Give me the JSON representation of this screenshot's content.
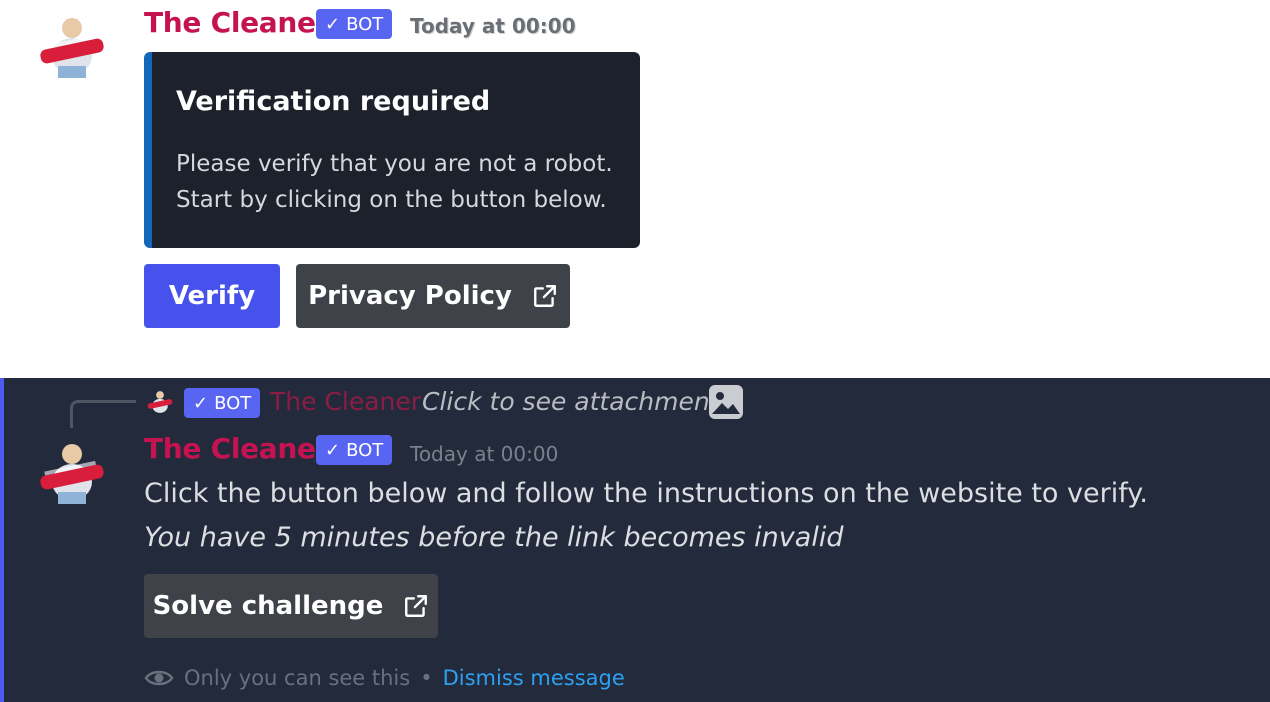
{
  "top_message": {
    "author": "The Cleaner",
    "badge": "BOT",
    "timestamp": "Today at 00:00",
    "embed": {
      "title": "Verification required",
      "description": "Please verify that you are not a robot.\nStart by clicking on the button below.",
      "accent_color": "#1267b9"
    },
    "buttons": {
      "verify": "Verify",
      "privacy": "Privacy Policy"
    }
  },
  "bottom_message": {
    "reply": {
      "badge": "BOT",
      "author": "The Cleaner",
      "text": "Click to see attachment",
      "icon": "image-icon"
    },
    "author": "The Cleaner",
    "badge": "BOT",
    "timestamp": "Today at 00:00",
    "line1": "Click the button below and follow the instructions on the website to verify.",
    "line2": "You have 5 minutes before the link becomes invalid",
    "button": "Solve challenge",
    "footer": {
      "only_you": "Only you can see this",
      "separator": "•",
      "dismiss": "Dismiss message"
    }
  },
  "colors": {
    "author_name": "#c51351",
    "bot_badge": "#5865f2",
    "primary_button": "#4752ec",
    "secondary_button": "#3f4248",
    "ephemeral_background": "#222a3c",
    "link": "#2ea0f0"
  }
}
